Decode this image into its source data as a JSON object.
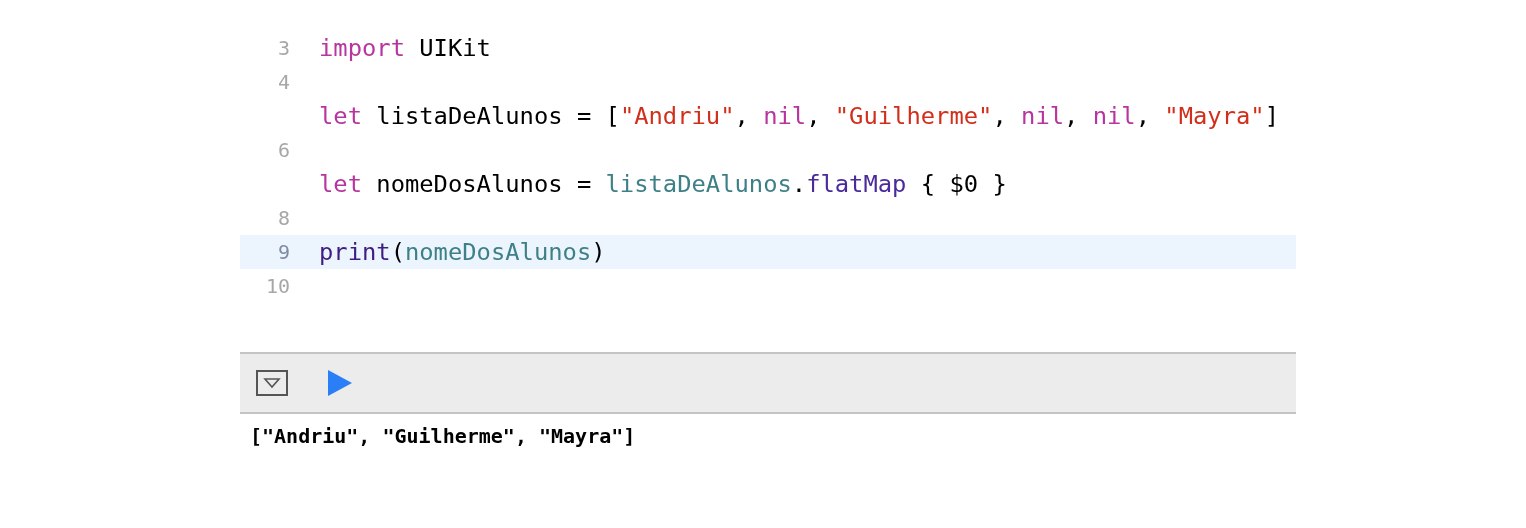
{
  "editor": {
    "lines": [
      {
        "number": "3",
        "selected": false,
        "tokens": [
          {
            "text": "import",
            "kind": "keyword"
          },
          {
            "text": " UIKit",
            "kind": "plain"
          }
        ]
      },
      {
        "number": "4",
        "selected": false
      },
      {
        "selected": false,
        "tokens": [
          {
            "text": "let",
            "kind": "keyword"
          },
          {
            "text": " listaDeAlunos = [",
            "kind": "plain"
          },
          {
            "text": "\"Andriu\"",
            "kind": "string"
          },
          {
            "text": ", ",
            "kind": "plain"
          },
          {
            "text": "nil",
            "kind": "keyword"
          },
          {
            "text": ", ",
            "kind": "plain"
          },
          {
            "text": "\"Guilherme\"",
            "kind": "string"
          },
          {
            "text": ", ",
            "kind": "plain"
          },
          {
            "text": "nil",
            "kind": "keyword"
          },
          {
            "text": ", ",
            "kind": "plain"
          },
          {
            "text": "nil",
            "kind": "keyword"
          },
          {
            "text": ", ",
            "kind": "plain"
          },
          {
            "text": "\"Mayra\"",
            "kind": "string"
          },
          {
            "text": "]",
            "kind": "plain"
          }
        ]
      },
      {
        "number": "6",
        "selected": false
      },
      {
        "selected": false,
        "tokens": [
          {
            "text": "let",
            "kind": "keyword"
          },
          {
            "text": " nomeDosAlunos = ",
            "kind": "plain"
          },
          {
            "text": "listaDeAlunos",
            "kind": "reference"
          },
          {
            "text": ".",
            "kind": "plain"
          },
          {
            "text": "flatMap",
            "kind": "method"
          },
          {
            "text": " { $0 }",
            "kind": "plain"
          }
        ]
      },
      {
        "number": "8",
        "selected": false
      },
      {
        "number": "9",
        "selected": true,
        "tokens": [
          {
            "text": "print",
            "kind": "function"
          },
          {
            "text": "(",
            "kind": "plain"
          },
          {
            "text": "nomeDosAlunos",
            "kind": "reference"
          },
          {
            "text": ")",
            "kind": "plain"
          }
        ]
      },
      {
        "number": "10",
        "selected": false
      }
    ]
  },
  "console": {
    "output": "[\"Andriu\", \"Guilherme\", \"Mayra\"]"
  }
}
